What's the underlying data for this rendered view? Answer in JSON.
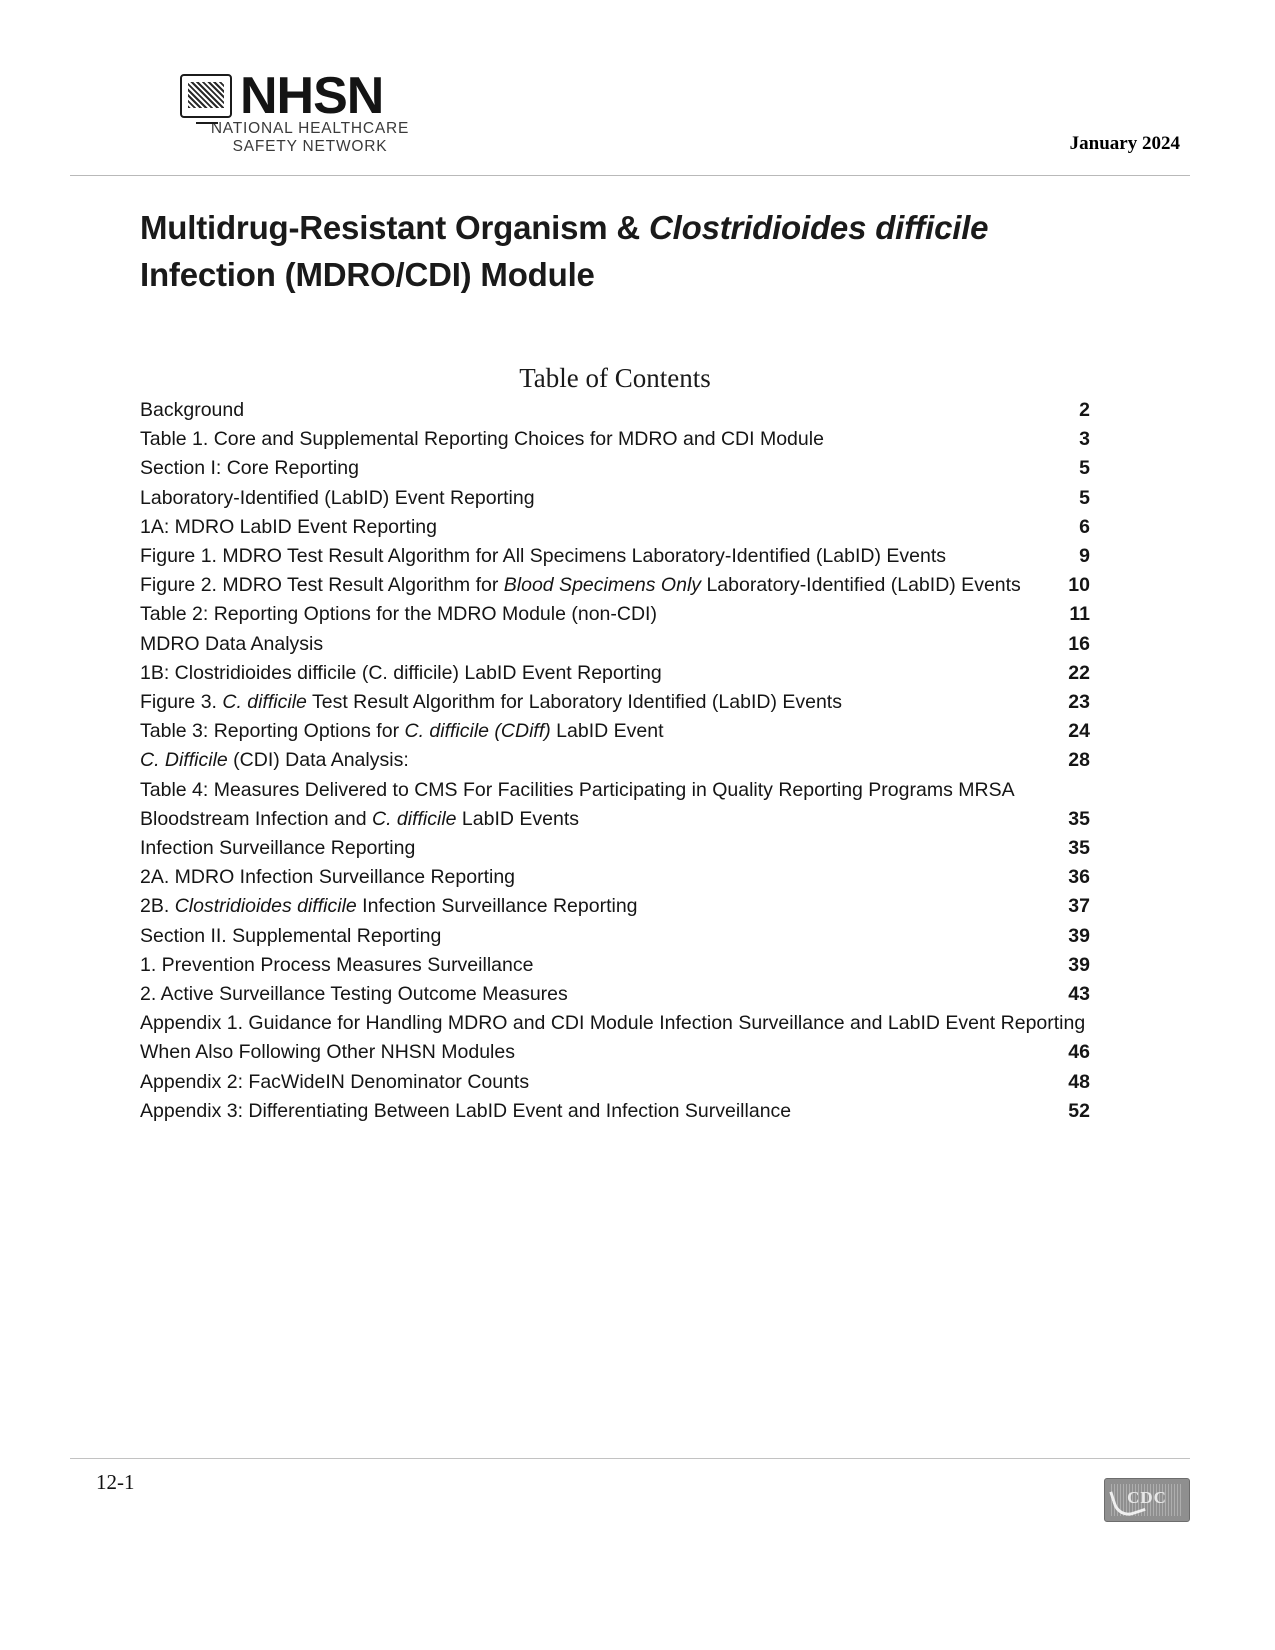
{
  "header": {
    "logo": {
      "wordmark": "NHSN",
      "line1": "NATIONAL HEALTHCARE",
      "line2": "SAFETY NETWORK",
      "icon": "nhsn-monitor-icon"
    },
    "date": "January 2024"
  },
  "title": {
    "line1_prefix": "Multidrug-Resistant Organism & ",
    "line1_italic": "Clostridioides difficile",
    "line2": "Infection (MDRO/CDI) Module"
  },
  "toc": {
    "heading": "Table of Contents",
    "entries": [
      {
        "text": "Background",
        "page": "2"
      },
      {
        "text": "Table 1.  Core and Supplemental Reporting Choices for MDRO and CDI Module",
        "page": "3"
      },
      {
        "text": "Section I: Core Reporting",
        "page": "5"
      },
      {
        "text": "Laboratory-Identified (LabID) Event Reporting",
        "page": "5"
      },
      {
        "text": "1A: MDRO LabID Event Reporting",
        "page": "6"
      },
      {
        "text": "Figure 1. MDRO Test Result Algorithm for All Specimens Laboratory-Identified (LabID) Events",
        "page": "9"
      },
      {
        "text": "Figure 2. MDRO Test Result Algorithm for <em>Blood Specimens Only</em> Laboratory-Identified (LabID) Events",
        "page": "10",
        "html": true
      },
      {
        "text": "Table 2: Reporting Options for the MDRO Module (non-CDI)",
        "page": "11"
      },
      {
        "text": "MDRO Data Analysis",
        "page": "16"
      },
      {
        "text": "1B: Clostridioides difficile (C. difficile) LabID Event Reporting",
        "page": "22"
      },
      {
        "text": "Figure 3.  <em>C. difficile</em> Test Result Algorithm for Laboratory Identified (LabID) Events",
        "page": "23",
        "html": true
      },
      {
        "text": "Table 3: Reporting Options for <em>C. difficile (CDiff)</em> LabID Event",
        "page": "24",
        "html": true
      },
      {
        "text": "<em>C. Difficile</em> (CDI) Data Analysis:",
        "page": "28",
        "html": true
      },
      {
        "text": "Table 4:  Measures Delivered to CMS For Facilities Participating in Quality Reporting Programs MRSA Bloodstream Infection and <em>C. difficile</em> LabID Events",
        "page": "35",
        "html": true,
        "wrap": true
      },
      {
        "text": "Infection Surveillance Reporting",
        "page": "35"
      },
      {
        "text": "2A. MDRO Infection Surveillance Reporting",
        "page": "36"
      },
      {
        "text": "2B. <em>Clostridioides difficile</em> Infection Surveillance Reporting",
        "page": "37",
        "html": true
      },
      {
        "text": "Section II. Supplemental Reporting",
        "page": "39"
      },
      {
        "text": "1. Prevention Process Measures Surveillance",
        "page": "39"
      },
      {
        "text": "2. Active Surveillance Testing Outcome Measures",
        "page": "43"
      },
      {
        "text": "Appendix 1. Guidance for Handling MDRO and CDI Module Infection Surveillance and LabID Event Reporting When Also Following Other NHSN Modules",
        "page": "46",
        "wrap": true
      },
      {
        "text": "Appendix 2: FacWideIN Denominator Counts",
        "page": "48"
      },
      {
        "text": "Appendix 3: Differentiating Between LabID Event and Infection Surveillance",
        "page": "52"
      }
    ]
  },
  "footer": {
    "page_number": "12-1",
    "badge_text": "CDC",
    "badge_icon": "cdc-logo-badge"
  }
}
